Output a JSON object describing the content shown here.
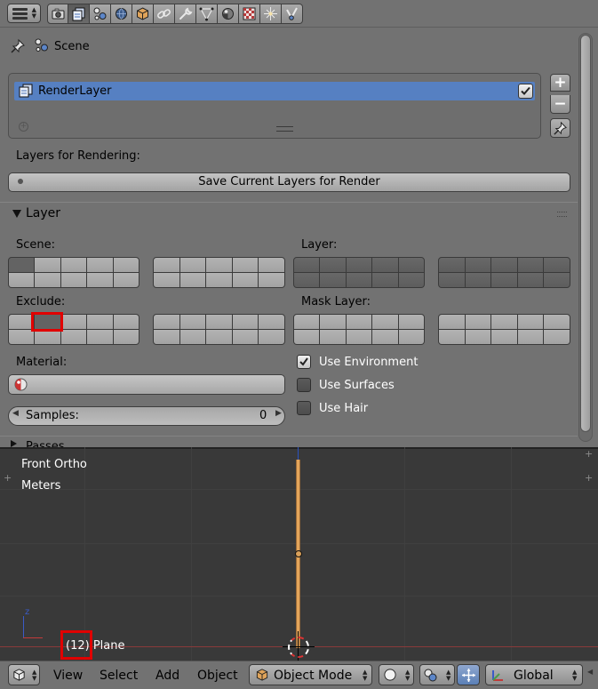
{
  "properties": {
    "context_tabs": [
      {
        "name": "render-tab",
        "icon": "camera-icon"
      },
      {
        "name": "render-layers-tab",
        "icon": "render-layers-icon"
      },
      {
        "name": "scene-tab",
        "icon": "scene-icon"
      },
      {
        "name": "world-tab",
        "icon": "world-icon"
      },
      {
        "name": "object-tab",
        "icon": "cube-icon"
      },
      {
        "name": "constraints-tab",
        "icon": "chain-icon"
      },
      {
        "name": "modifiers-tab",
        "icon": "wrench-icon"
      },
      {
        "name": "data-tab",
        "icon": "mesh-icon"
      },
      {
        "name": "material-tab",
        "icon": "material-sphere-icon"
      },
      {
        "name": "texture-tab",
        "icon": "checker-icon"
      },
      {
        "name": "particles-tab",
        "icon": "particles-icon"
      },
      {
        "name": "physics-tab",
        "icon": "physics-icon"
      }
    ],
    "active_tab": "render-layers-tab",
    "breadcrumb_scene": "Scene",
    "render_layer_item": "RenderLayer",
    "layers_for_rendering_label": "Layers for Rendering:",
    "save_layers_button": "Save Current Layers for Render",
    "layer_panel_title": "Layer",
    "scene_label": "Scene:",
    "layer_label": "Layer:",
    "exclude_label": "Exclude:",
    "mask_layer_label": "Mask Layer:",
    "material_label": "Material:",
    "samples_label": "Samples:",
    "samples_value": "0",
    "use_environment_label": "Use Environment",
    "use_environment_checked": true,
    "use_surfaces_label": "Use Surfaces",
    "use_surfaces_checked": false,
    "use_hair_label": "Use Hair",
    "use_hair_checked": false,
    "next_panel_title": "Passes"
  },
  "viewport": {
    "view_name": "Front Ortho",
    "units": "Meters",
    "object_info": "(12) Plane",
    "axis_z_label": "z"
  },
  "footer": {
    "menu_view": "View",
    "menu_select": "Select",
    "menu_add": "Add",
    "menu_object": "Object",
    "mode": "Object Mode",
    "orientation": "Global"
  },
  "colors": {
    "selection_blue": "#5680c2",
    "highlight_red": "#e10000",
    "object_orange": "#e3a55b"
  }
}
